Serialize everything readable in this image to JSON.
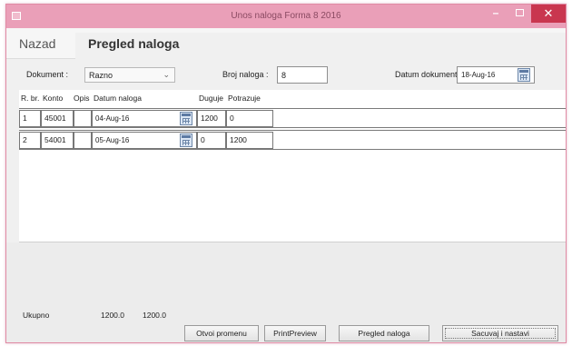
{
  "window": {
    "title": "Unos naloga Forma 8 2016"
  },
  "nav": {
    "back_label": "Nazad",
    "tab_active_label": "Pregled naloga"
  },
  "filters": {
    "document_label": "Dokument :",
    "document_value": "Razno",
    "order_number_label": "Broj naloga :",
    "order_number_value": "8",
    "doc_date_label": "Datum dokumenta",
    "doc_date_value": "18-Aug-16"
  },
  "table": {
    "columns": [
      "R. br.",
      "Konto",
      "Opis",
      "Datum naloga",
      "Duguje",
      "Potrazuje"
    ],
    "rows": [
      {
        "rb": "1",
        "konto": "45001",
        "opis": "",
        "datum": "04-Aug-16",
        "duguje": "1200",
        "potrazuje": "0"
      },
      {
        "rb": "2",
        "konto": "54001",
        "opis": "",
        "datum": "05-Aug-16",
        "duguje": "0",
        "potrazuje": "1200"
      }
    ]
  },
  "totals": {
    "label": "Ukupno",
    "duguje": "1200.0",
    "potrazuje": "1200.0"
  },
  "buttons": {
    "save_changes": "Otvoi promenu",
    "print_preview": "PrintPreview",
    "review_orders": "Pregled naloga",
    "save_new": "Sacuvaj i nastavi"
  },
  "colors": {
    "titlebar": "#ea9fb8",
    "close_button": "#c9364f"
  }
}
